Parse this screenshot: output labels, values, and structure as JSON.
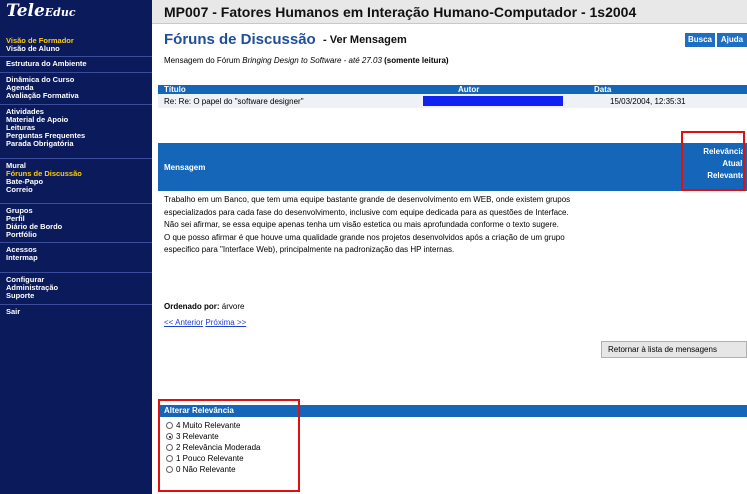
{
  "sidebar": {
    "logo": {
      "main": "TeleEduc"
    },
    "groups": [
      [
        "Visão de Formador",
        "Visão de Aluno"
      ],
      [
        "Estrutura do Ambiente"
      ],
      [
        "Dinâmica do Curso",
        "Agenda",
        "Avaliação Formativa"
      ],
      [
        "Atividades",
        "Material de Apoio",
        "Leituras",
        "Perguntas Frequentes",
        "Parada Obrigatória"
      ],
      [
        "Mural",
        "Fóruns de Discussão",
        "Bate-Papo",
        "Correio"
      ],
      [
        "Grupos",
        "Perfil",
        "Diário de Bordo",
        "Portfólio"
      ],
      [
        "Acessos",
        "Intermap"
      ],
      [
        "Configurar",
        "Administração",
        "Suporte"
      ],
      [
        "Sair"
      ]
    ]
  },
  "header": {
    "course_title": "MP007 - Fatores Humanos em Interação Humano-Computador - 1s2004"
  },
  "page": {
    "title": "Fóruns de Discussão",
    "subtitle": "- Ver Mensagem",
    "busca": "Busca",
    "ajuda": "Ajuda",
    "forum_prefix": "Mensagem do Fórum ",
    "forum_name": "Bringing Design to Software - até 27.03",
    "forum_mode": "(somente leitura)"
  },
  "table": {
    "headers": {
      "title": "Título",
      "author": "Autor",
      "date": "Data"
    },
    "row": {
      "title": "Re: Re: O papel do \"software designer\"",
      "date": "15/03/2004, 12:35:31"
    }
  },
  "message": {
    "label": "Mensagem",
    "relevance_lines": [
      "Relevância",
      "Atual:",
      "Relevante"
    ],
    "body": [
      "Trabalho em um Banco, que tem uma equipe bastante grande de desenvolvimento em WEB, onde existem grupos",
      "especializados para cada fase do desenvolvimento, inclusive com equipe dedicada para as questões de Interface.",
      "Não sei afirmar, se essa equipe apenas tenha um visão estetica ou mais aprofundada conforme o texto sugere.",
      "O que posso afirmar é que houve uma qualidade grande nos projetos desenvolvidos após a criação de um grupo",
      "especifico para \"Interface Web), principalmente na padronização das HP internas."
    ]
  },
  "ordering": {
    "label": "Ordenado por:",
    "value": "árvore"
  },
  "pager": {
    "prev": "<< Anterior",
    "next": "Próxima >>"
  },
  "return_button": "Retornar à lista de mensagens",
  "relevance": {
    "header": "Alterar Relevância",
    "options": [
      "4 Muito Relevante",
      "3 Relevante",
      "2 Relevância Moderada",
      "1 Pouco Relevante",
      "0 Não Relevante"
    ],
    "selected": "3 Relevante"
  },
  "colors": {
    "sidebar_bg": "#0b1a5a",
    "active_nav": "#ffcc00",
    "band_blue": "#1565b8",
    "title_blue": "#1e4f9a",
    "highlight_red": "#e01010",
    "author_redaction": "#1022f0"
  }
}
